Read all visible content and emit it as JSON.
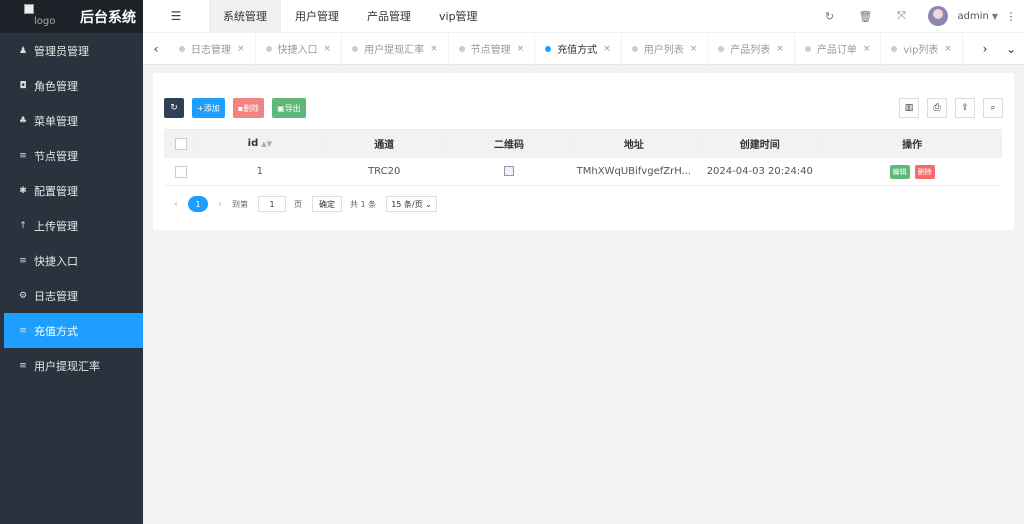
{
  "app": {
    "logo_alt": "logo",
    "title": "后台系统"
  },
  "sidebar": {
    "items": [
      {
        "label": "管理员管理",
        "icon": "user-icon",
        "glyph": "♟"
      },
      {
        "label": "角色管理",
        "icon": "shield-icon",
        "glyph": "◘"
      },
      {
        "label": "菜单管理",
        "icon": "tree-icon",
        "glyph": "♣"
      },
      {
        "label": "节点管理",
        "icon": "list-icon",
        "glyph": "≡"
      },
      {
        "label": "配置管理",
        "icon": "asterisk-icon",
        "glyph": "✱"
      },
      {
        "label": "上传管理",
        "icon": "upload-icon",
        "glyph": "↑"
      },
      {
        "label": "快捷入口",
        "icon": "list-icon",
        "glyph": "≡"
      },
      {
        "label": "日志管理",
        "icon": "gear-icon",
        "glyph": "⚙"
      },
      {
        "label": "充值方式",
        "icon": "list-icon",
        "glyph": "≡",
        "active": true
      },
      {
        "label": "用户提现汇率",
        "icon": "list-icon",
        "glyph": "≡"
      }
    ]
  },
  "header": {
    "nav": [
      "系统管理",
      "用户管理",
      "产品管理",
      "vip管理"
    ],
    "active_nav": "系统管理",
    "user": "admin"
  },
  "tabs": [
    {
      "label": "日志管理"
    },
    {
      "label": "快捷入口"
    },
    {
      "label": "用户提现汇率"
    },
    {
      "label": "节点管理"
    },
    {
      "label": "充值方式",
      "active": true
    },
    {
      "label": "用户列表"
    },
    {
      "label": "产品列表"
    },
    {
      "label": "产品订单"
    },
    {
      "label": "vip列表"
    }
  ],
  "toolbar": {
    "add_label": "添加",
    "delete_label": "删除",
    "export_label": "导出"
  },
  "table": {
    "headers": [
      "id",
      "通道",
      "二维码",
      "地址",
      "创建时间",
      "操作"
    ],
    "rows": [
      {
        "id": "1",
        "channel": "TRC20",
        "address": "TMhXWqUBifvgefZrH...",
        "created": "2024-04-03 20:24:40",
        "edit_label": "编辑",
        "delete_label": "删除"
      }
    ]
  },
  "pager": {
    "current_page": "1",
    "goto_label": "到第",
    "page_input": "1",
    "page_unit": "页",
    "confirm_label": "确定",
    "total_label": "共 1 条",
    "page_size": "15 条/页"
  },
  "colors": {
    "accent": "#1e9fff",
    "sidebar_bg": "#28333e",
    "green": "#5fb878",
    "red": "#f56c6c"
  }
}
